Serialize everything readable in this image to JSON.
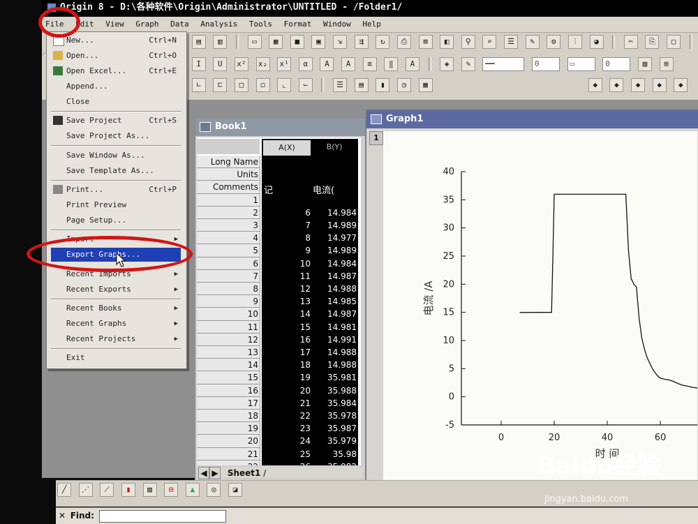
{
  "window": {
    "title": "Origin 8 - D:\\各种软件\\Origin\\Administrator\\UNTITLED - /Folder1/"
  },
  "menubar": [
    "File",
    "Edit",
    "View",
    "Graph",
    "Data",
    "Analysis",
    "Tools",
    "Format",
    "Window",
    "Help"
  ],
  "file_menu": {
    "items": [
      {
        "label": "New...",
        "shortcut": "Ctrl+N"
      },
      {
        "label": "Open...",
        "shortcut": "Ctrl+O"
      },
      {
        "label": "Open Excel...",
        "shortcut": "Ctrl+E"
      },
      {
        "label": "Append..."
      },
      {
        "label": "Close"
      },
      {
        "label": "Save Project",
        "shortcut": "Ctrl+S"
      },
      {
        "label": "Save Project As..."
      },
      {
        "label": "Save Window As..."
      },
      {
        "label": "Save Template As..."
      },
      {
        "label": "Print...",
        "shortcut": "Ctrl+P"
      },
      {
        "label": "Print Preview"
      },
      {
        "label": "Page Setup..."
      },
      {
        "label": "Import"
      },
      {
        "label": "Export Graphs..."
      },
      {
        "label": "Recent Imports"
      },
      {
        "label": "Recent Exports"
      },
      {
        "label": "Recent Books"
      },
      {
        "label": "Recent Graphs"
      },
      {
        "label": "Recent Projects"
      },
      {
        "label": "Exit"
      }
    ],
    "highlighted": "Export Graphs..."
  },
  "toolbar": {
    "zero_a": "0",
    "zero_b": "0"
  },
  "book1": {
    "title": "Book1",
    "columns": [
      "A(X)",
      "B(Y)"
    ],
    "row_headers": [
      "Long Name",
      "Units",
      "Comments"
    ],
    "comments_values": [
      "记",
      "电流("
    ],
    "rows": [
      [
        "1",
        "",
        ""
      ],
      [
        "2",
        "6",
        "14.984"
      ],
      [
        "3",
        "7",
        "14.989"
      ],
      [
        "4",
        "8",
        "14.977"
      ],
      [
        "5",
        "9",
        "14.989"
      ],
      [
        "6",
        "10",
        "14.984"
      ],
      [
        "7",
        "11",
        "14.987"
      ],
      [
        "8",
        "12",
        "14.988"
      ],
      [
        "9",
        "13",
        "14.985"
      ],
      [
        "10",
        "14",
        "14.987"
      ],
      [
        "11",
        "15",
        "14.981"
      ],
      [
        "12",
        "16",
        "14.991"
      ],
      [
        "13",
        "17",
        "14.988"
      ],
      [
        "14",
        "18",
        "14.988"
      ],
      [
        "15",
        "19",
        "35.981"
      ],
      [
        "16",
        "20",
        "35.988"
      ],
      [
        "17",
        "21",
        "35.984"
      ],
      [
        "18",
        "22",
        "35.978"
      ],
      [
        "19",
        "23",
        "35.987"
      ],
      [
        "20",
        "24",
        "35.979"
      ],
      [
        "21",
        "25",
        "35.98"
      ],
      [
        "22",
        "26",
        "35.982"
      ]
    ],
    "sheet_tab": "Sheet1"
  },
  "graph1": {
    "title": "Graph1",
    "layer": "1"
  },
  "chart_data": {
    "type": "line",
    "title": "",
    "xlabel": "时 间",
    "ylabel": "电流 /A",
    "xlim": [
      -15,
      75
    ],
    "ylim": [
      -5,
      40
    ],
    "xticks": [
      0,
      20,
      40,
      60
    ],
    "yticks": [
      -5,
      0,
      5,
      10,
      15,
      20,
      25,
      30,
      35,
      40
    ],
    "series": [
      {
        "x": [
          7,
          8,
          10,
          12,
          14,
          16,
          18,
          19,
          19.5,
          20,
          22,
          25,
          30,
          35,
          40,
          45,
          47,
          48,
          49,
          50,
          51,
          52,
          53,
          54,
          55,
          56,
          57,
          58,
          59,
          60,
          62,
          64,
          66,
          68,
          70,
          72,
          75
        ],
        "y": [
          14.98,
          14.98,
          14.98,
          14.99,
          14.99,
          14.99,
          14.99,
          14.99,
          25,
          35.98,
          35.98,
          35.98,
          35.98,
          35.98,
          35.98,
          35.98,
          35.98,
          26,
          21,
          20,
          19.5,
          14,
          10.5,
          8.5,
          7,
          6,
          5,
          4.3,
          3.7,
          3.3,
          3.1,
          2.9,
          2.5,
          2.1,
          1.9,
          1.7,
          1.5
        ]
      }
    ],
    "grid": false
  },
  "bottom": {
    "find_label": "Find:"
  },
  "watermark": {
    "text": "Baidu经验",
    "url": "jingyan.baidu.com"
  }
}
